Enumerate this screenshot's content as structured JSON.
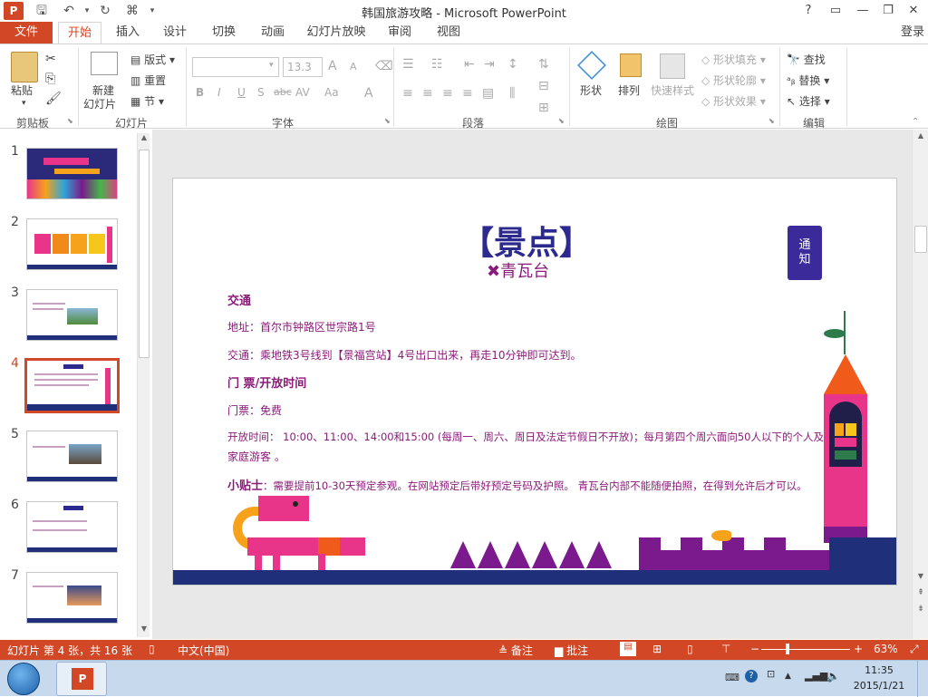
{
  "window": {
    "title": "韩国旅游攻略 - Microsoft PowerPoint",
    "help": "?",
    "login": "登录"
  },
  "tabs": [
    "文件",
    "开始",
    "插入",
    "设计",
    "切换",
    "动画",
    "幻灯片放映",
    "审阅",
    "视图"
  ],
  "ribbon": {
    "clipboard": {
      "paste": "粘贴",
      "label": "剪贴板"
    },
    "slides": {
      "new_slide": "新建",
      "new_slide2": "幻灯片",
      "layout": "版式",
      "reset": "重置",
      "section": "节",
      "label": "幻灯片"
    },
    "font": {
      "size": "13.3",
      "bold": "B",
      "italic": "I",
      "underline": "U",
      "shadow": "S",
      "strike": "abc",
      "spacing": "AV",
      "case": "Aa",
      "color": "A",
      "grow": "A",
      "shrink": "A",
      "label": "字体"
    },
    "paragraph": {
      "label": "段落"
    },
    "drawing": {
      "shape": "形状",
      "arrange": "排列",
      "quick_style": "快速样式",
      "fill": "形状填充",
      "outline": "形状轮廓",
      "effect": "形状效果",
      "label": "绘图"
    },
    "editing": {
      "find": "查找",
      "replace": "替换",
      "select": "选择",
      "label": "编辑"
    }
  },
  "thumbnails": [
    {
      "num": "1"
    },
    {
      "num": "2"
    },
    {
      "num": "3"
    },
    {
      "num": "4"
    },
    {
      "num": "5"
    },
    {
      "num": "6"
    },
    {
      "num": "7"
    }
  ],
  "slide": {
    "title": "【景点】",
    "subtitle": "✖青瓦台",
    "notice": "通知",
    "heading1": "交通",
    "address": "地址：首尔市钟路区世宗路1号",
    "transport": "交通：乘地铁3号线到【景福宫站】4号出口出来，再走10分钟即可达到。",
    "heading2": "门 票/开放时间",
    "ticket": "门票：免费",
    "hours1": "开放时间： 10:00、11:00、14:00和15:00 (每周一、周六、周日及法定节假日不开放)；每月第四个周六面向50人以下的个人及",
    "hours2": "家庭游客 。",
    "tip_label": "小贴士",
    "tip": "：需要提前10-30天预定参观。在网站预定后带好预定号码及护照。 青瓦台内部不能随便拍照，在得到允许后才可以。"
  },
  "status": {
    "slide_info": "幻灯片 第 4 张，共 16 张",
    "language": "中文(中国)",
    "notes": "备注",
    "comments": "批注",
    "zoom": "63%"
  },
  "taskbar": {
    "time": "11:35",
    "date": "2015/1/21"
  },
  "colors": {
    "accent": "#d24726",
    "slide_text": "#8b1b7a",
    "slide_title": "#2c2a8f",
    "magenta": "#e8358a",
    "navy": "#1f2f7a",
    "purple": "#7a1a8c"
  }
}
